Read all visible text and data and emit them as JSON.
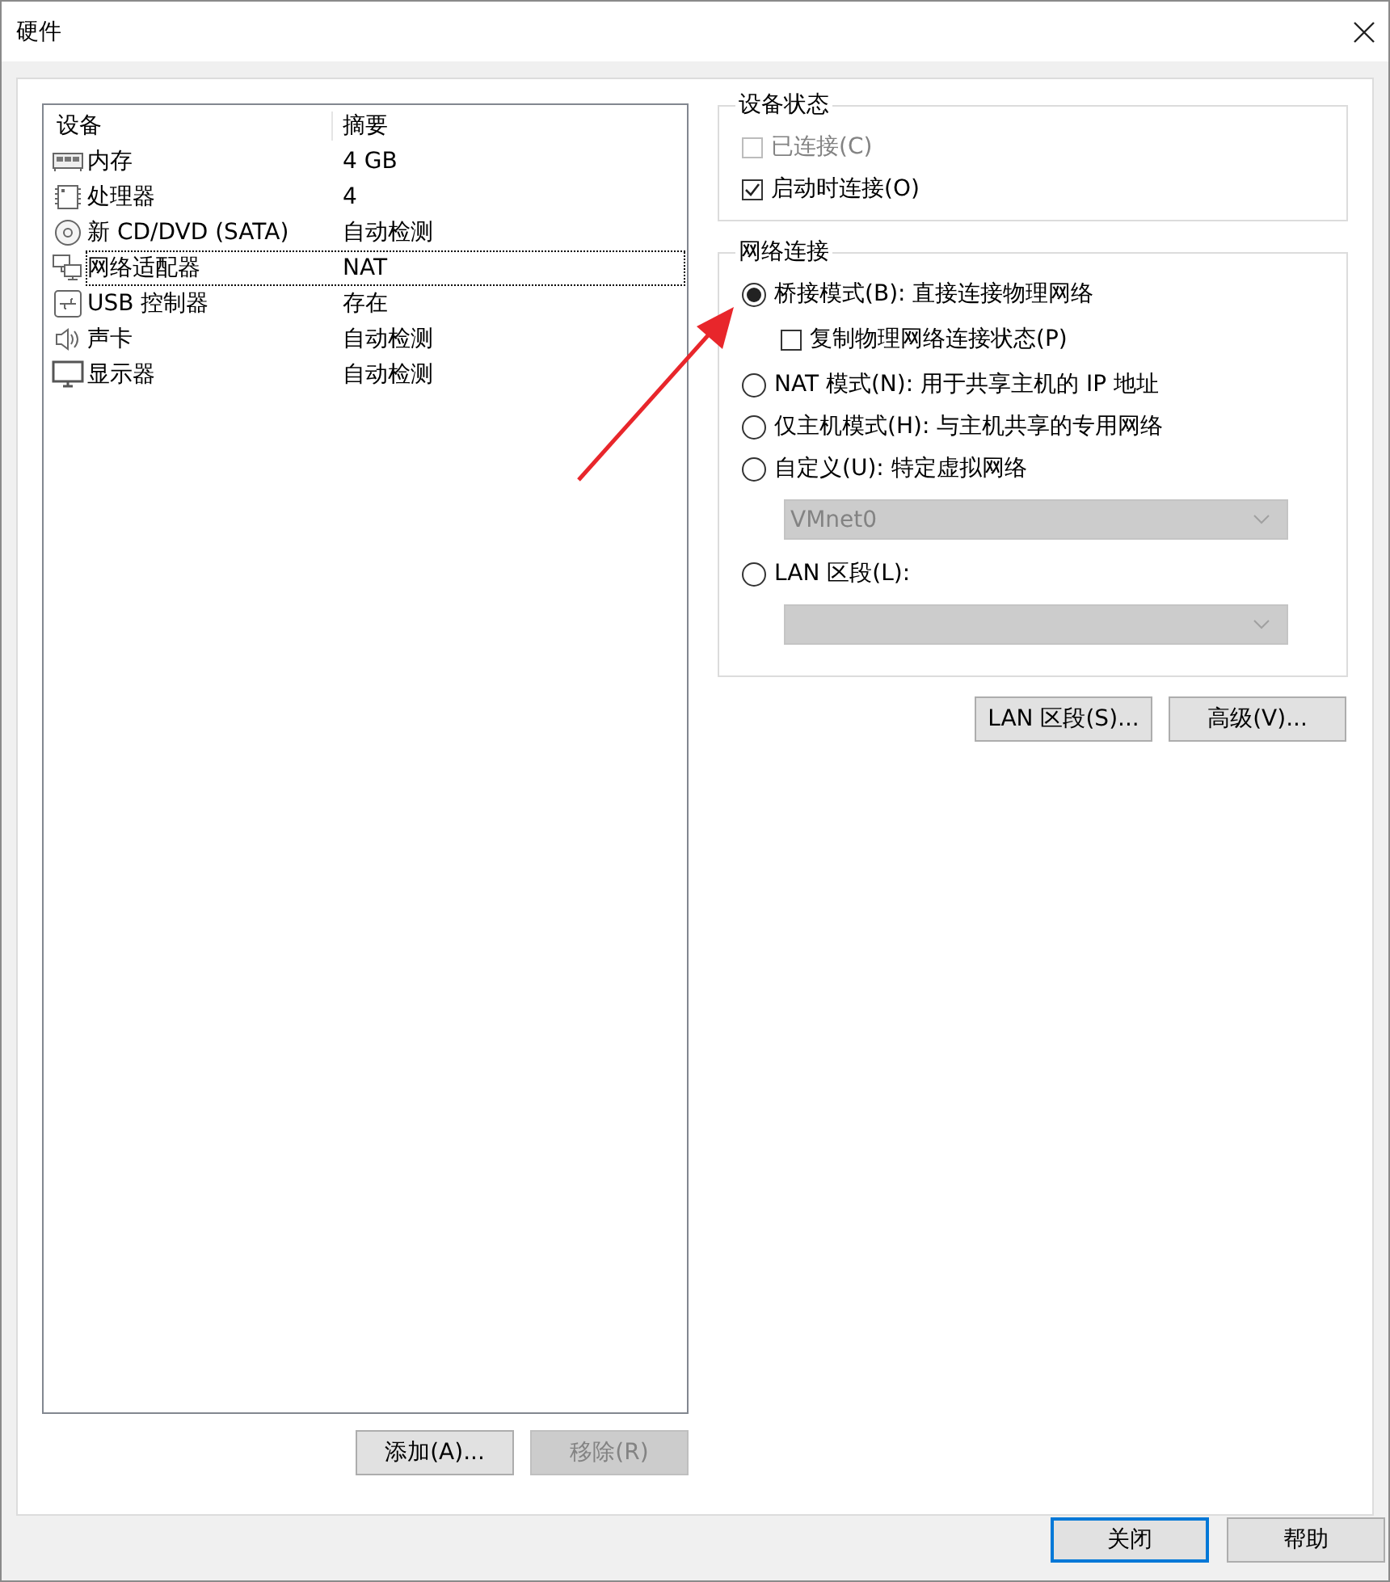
{
  "window": {
    "title": "硬件"
  },
  "device_table": {
    "columns": [
      "设备",
      "摘要"
    ],
    "rows": [
      {
        "kind": "memory",
        "device": "内存",
        "summary": "4 GB",
        "selected": false
      },
      {
        "kind": "cpu",
        "device": "处理器",
        "summary": "4",
        "selected": false
      },
      {
        "kind": "cdrom",
        "device": "新 CD/DVD (SATA)",
        "summary": "自动检测",
        "selected": false
      },
      {
        "kind": "network",
        "device": "网络适配器",
        "summary": "NAT",
        "selected": true
      },
      {
        "kind": "usb",
        "device": "USB 控制器",
        "summary": "存在",
        "selected": false
      },
      {
        "kind": "sound",
        "device": "声卡",
        "summary": "自动检测",
        "selected": false
      },
      {
        "kind": "display",
        "device": "显示器",
        "summary": "自动检测",
        "selected": false
      }
    ]
  },
  "device_buttons": [
    {
      "label": "添加(A)...",
      "disabled": false
    },
    {
      "label": "移除(R)",
      "disabled": true
    }
  ],
  "device_status": {
    "title": "设备状态",
    "options": [
      {
        "label": "已连接(C)",
        "checked": false,
        "disabled": true
      },
      {
        "label": "启动时连接(O)",
        "checked": true,
        "disabled": false
      }
    ]
  },
  "network": {
    "title": "网络连接",
    "items": [
      {
        "kind": "radio",
        "label": "桥接模式(B): 直接连接物理网络",
        "selected": true
      },
      {
        "kind": "checkbox",
        "label": "复制物理网络连接状态(P)",
        "checked": false
      },
      {
        "kind": "radio",
        "label": "NAT 模式(N): 用于共享主机的 IP 地址",
        "selected": false
      },
      {
        "kind": "radio",
        "label": "仅主机模式(H): 与主机共享的专用网络",
        "selected": false
      },
      {
        "kind": "radio",
        "label": "自定义(U): 特定虚拟网络",
        "selected": false
      },
      {
        "kind": "dropdown",
        "value": "VMnet0",
        "disabled": true
      },
      {
        "kind": "radio",
        "label": "LAN 区段(L):",
        "selected": false
      },
      {
        "kind": "dropdown",
        "disabled": true
      }
    ]
  },
  "network_buttons": [
    {
      "label": "LAN 区段(S)..."
    },
    {
      "label": "高级(V)..."
    }
  ],
  "footer_buttons": [
    {
      "label": "关闭",
      "default": true
    },
    {
      "label": "帮助",
      "default": false
    }
  ]
}
